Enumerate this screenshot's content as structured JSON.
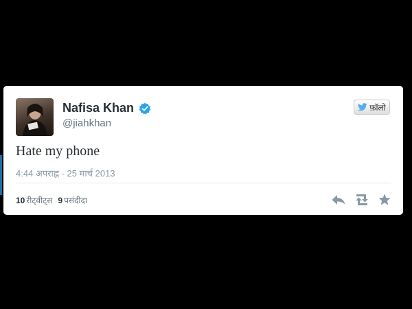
{
  "tweet": {
    "display_name": "Nafisa Khan",
    "handle": "@jiahkhan",
    "text": "Hate my phone",
    "timestamp": "4:44 अपराह्न - 25 मार्च 2013",
    "follow_label": "फ़ॉलो",
    "retweets": {
      "count": "10",
      "label": "रीट्वीट्स"
    },
    "favorites": {
      "count": "9",
      "label": "पसंदीदा"
    },
    "verified": true
  },
  "icons": {
    "verified": "verified-badge-icon",
    "follow": "twitter-bird-icon",
    "reply": "reply-icon",
    "retweet": "retweet-icon",
    "favorite": "star-icon"
  },
  "colors": {
    "background": "#000000",
    "card": "#ffffff",
    "verified_blue": "#2aa3ef",
    "twitter_blue": "#55acee",
    "muted_text": "#66757f",
    "action_gray": "#8899a6"
  }
}
